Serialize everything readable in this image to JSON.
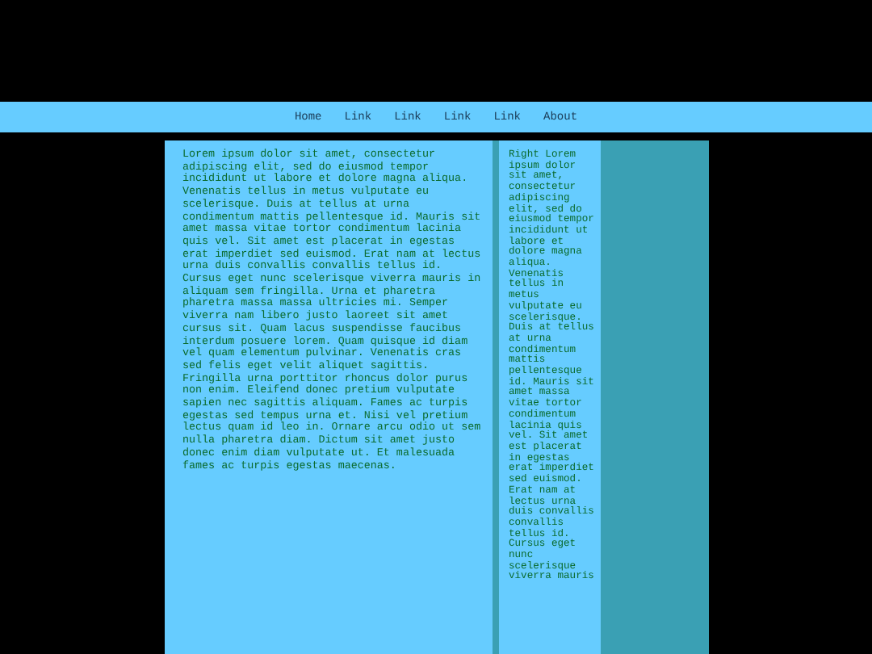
{
  "nav": {
    "links": [
      "Home",
      "Link",
      "Link",
      "Link",
      "Link",
      "About"
    ]
  },
  "main": {
    "text": "Lorem ipsum dolor sit amet, consectetur adipiscing elit, sed do eiusmod tempor incididunt ut labore et dolore magna aliqua. Venenatis tellus in metus vulputate eu scelerisque. Duis at tellus at urna condimentum mattis pellentesque id. Mauris sit amet massa vitae tortor condimentum lacinia quis vel. Sit amet est placerat in egestas erat imperdiet sed euismod. Erat nam at lectus urna duis convallis convallis tellus id. Cursus eget nunc scelerisque viverra mauris in aliquam sem fringilla. Urna et pharetra pharetra massa massa ultricies mi. Semper viverra nam libero justo laoreet sit amet cursus sit. Quam lacus suspendisse faucibus interdum posuere lorem. Quam quisque id diam vel quam elementum pulvinar. Venenatis cras sed felis eget velit aliquet sagittis. Fringilla urna porttitor rhoncus dolor purus non enim. Eleifend donec pretium vulputate sapien nec sagittis aliquam. Fames ac turpis egestas sed tempus urna et. Nisi vel pretium lectus quam id leo in. Ornare arcu odio ut sem nulla pharetra diam. Dictum sit amet justo donec enim diam vulputate ut. Et malesuada fames ac turpis egestas maecenas."
  },
  "sidebar": {
    "text": "Right Lorem ipsum dolor sit amet, consectetur adipiscing elit, sed do eiusmod tempor incididunt ut labore et dolore magna aliqua. Venenatis tellus in metus vulputate eu scelerisque. Duis at tellus at urna condimentum mattis pellentesque id. Mauris sit amet massa vitae tortor condimentum lacinia quis vel. Sit amet est placerat in egestas erat imperdiet sed euismod. Erat nam at lectus urna duis convallis convallis tellus id. Cursus eget nunc scelerisque viverra mauris"
  }
}
